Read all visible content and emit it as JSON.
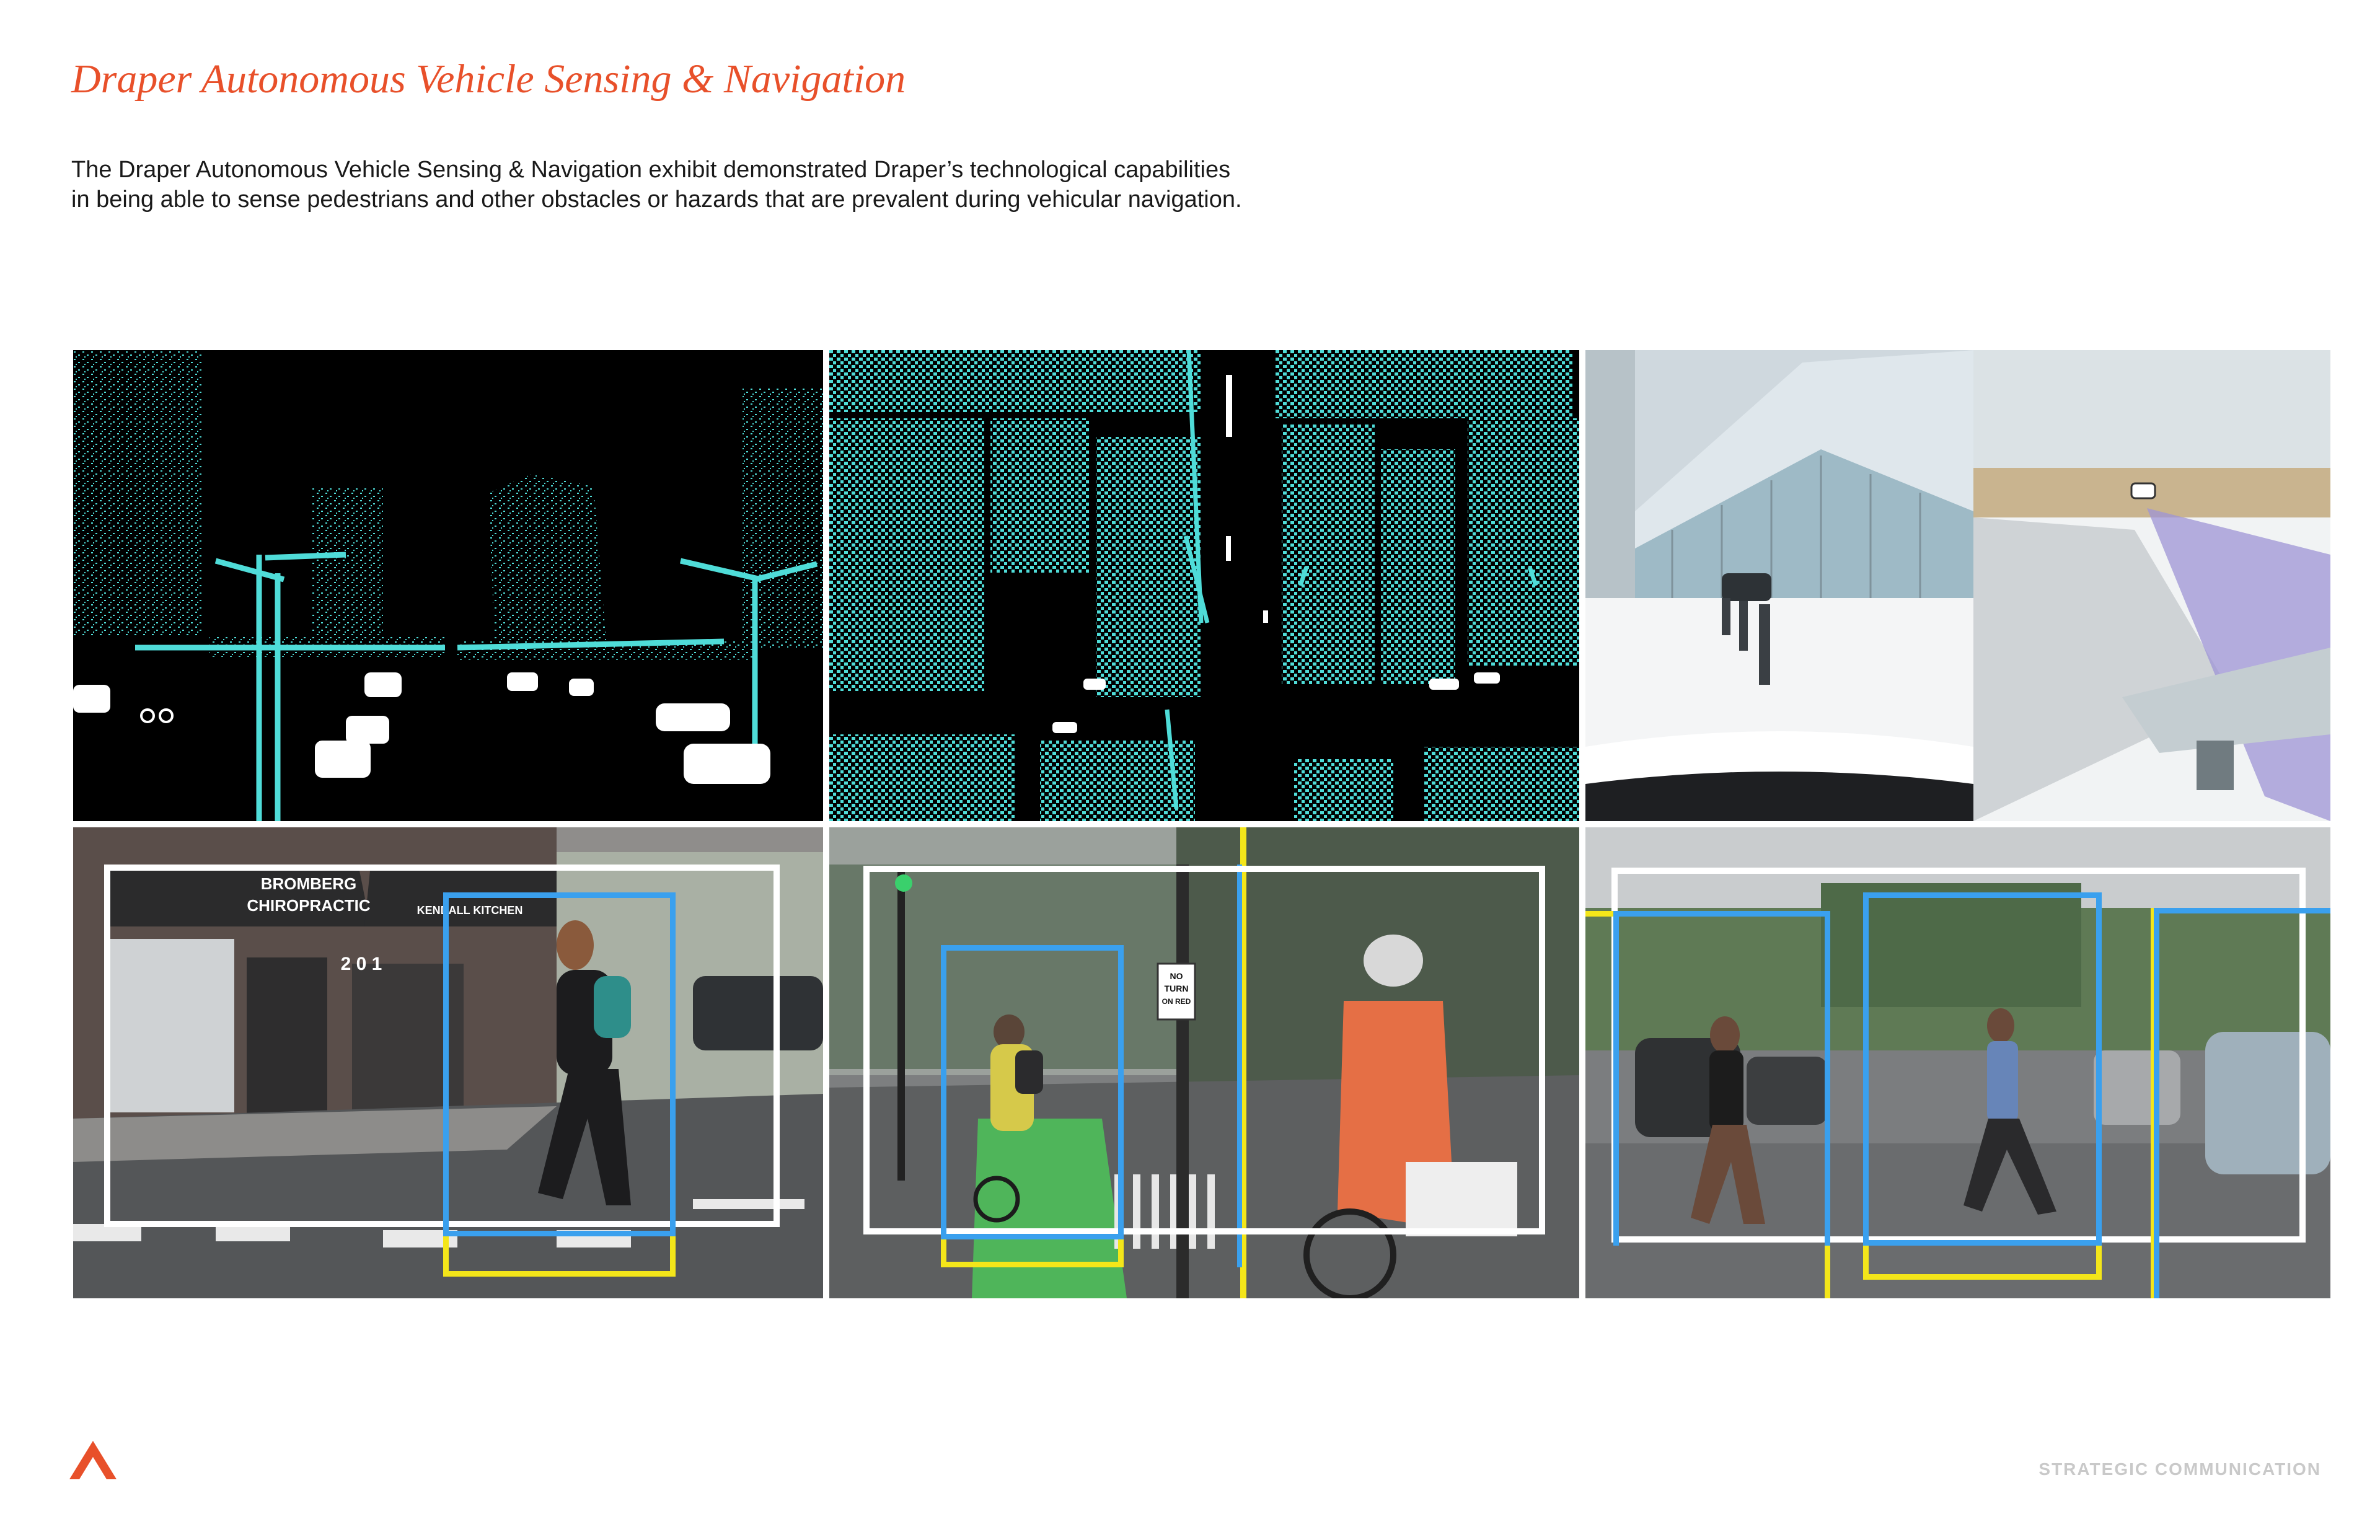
{
  "page": {
    "title": "Draper Autonomous Vehicle Sensing & Navigation",
    "description_lines": [
      "The Draper Autonomous Vehicle Sensing & Navigation exhibit demonstrated Draper’s technological capabilities",
      "in being able to sense pedestrians and other obstacles or hazards that are prevalent during vehicular navigation."
    ],
    "footer": "STRATEGIC COMMUNICATION"
  },
  "images": {
    "pedestrian_scene": {
      "storefront_sign": [
        "BROMBERG",
        "CHIROPRACTIC"
      ],
      "awning_text": "KENDALL KITCHEN",
      "door_number": "2 0 1"
    },
    "cyclist_scene": {
      "road_sign": [
        "NO",
        "TURN",
        "ON RED"
      ]
    }
  },
  "colors": {
    "accent": "#e8502a",
    "lidar": "#4fdcd8",
    "box_blue": "#3aa0ee",
    "box_yellow": "#f4e61a",
    "box_white": "#ffffff",
    "footer": "#c9c9c9"
  }
}
